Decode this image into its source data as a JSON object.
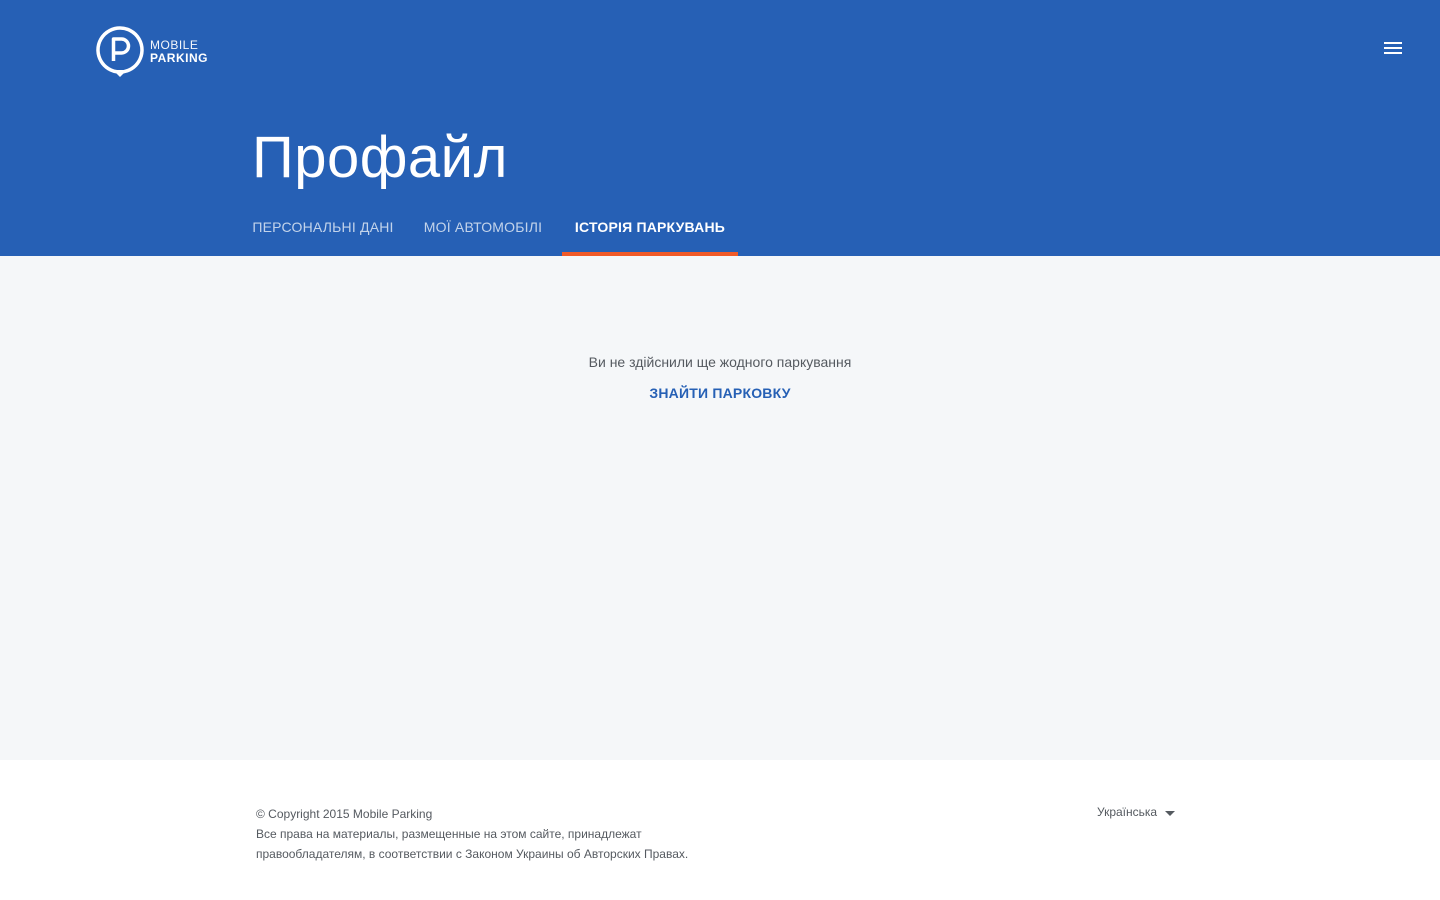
{
  "app": {
    "logo_line1": "MOBILE",
    "logo_line2": "PARKING"
  },
  "header": {
    "title": "Профайл",
    "menu_icon": "hamburger-menu-icon",
    "tabs": [
      {
        "label": "ПЕРСОНАЛЬНІ ДАНІ",
        "active": false
      },
      {
        "label": "МОЇ АВТОМОБІЛІ",
        "active": false
      },
      {
        "label": "ІСТОРІЯ ПАРКУВАНЬ",
        "active": true
      }
    ]
  },
  "main": {
    "empty_message": "Ви не здійснили ще жодного паркування",
    "find_parking_label": "ЗНАЙТИ ПАРКОВКУ"
  },
  "footer": {
    "copyright": "© Copyright 2015 Mobile Parking",
    "rights_line1": "Все права на материалы, размещенные на этом сайте, принадлежат",
    "rights_line2": "правообладателям, в соответствии с Законом Украины об Авторских Правах.",
    "language": "Українська"
  },
  "colors": {
    "brand_blue": "#2660b5",
    "tab_indicator": "#f05a28",
    "content_bg": "#f5f7f9"
  }
}
